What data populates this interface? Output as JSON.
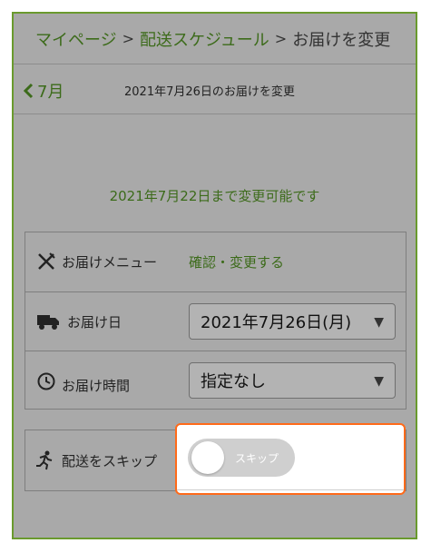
{
  "breadcrumb": {
    "items": [
      "マイページ",
      "配送スケジュール",
      "お届けを変更"
    ],
    "separator": ">"
  },
  "subheader": {
    "back_label": "7月",
    "title": "2021年7月26日のお届けを変更"
  },
  "deadline_text": "2021年7月22日まで変更可能です",
  "rows": {
    "menu": {
      "label": "お届けメニュー",
      "link": "確認・変更する",
      "icon": "fork-knife-icon"
    },
    "date": {
      "label": "お届け日",
      "value": "2021年7月26日(月)",
      "icon": "truck-icon"
    },
    "time": {
      "label": "お届け時間",
      "value": "指定なし",
      "icon": "clock-icon"
    },
    "skip": {
      "label": "配送をスキップ",
      "toggle_label": "スキップ",
      "toggle_on": false,
      "icon": "running-person-icon"
    }
  },
  "colors": {
    "accent": "#3c6b1a",
    "overlay": "#a9a9a9",
    "highlight_border": "#ff6a1a"
  }
}
